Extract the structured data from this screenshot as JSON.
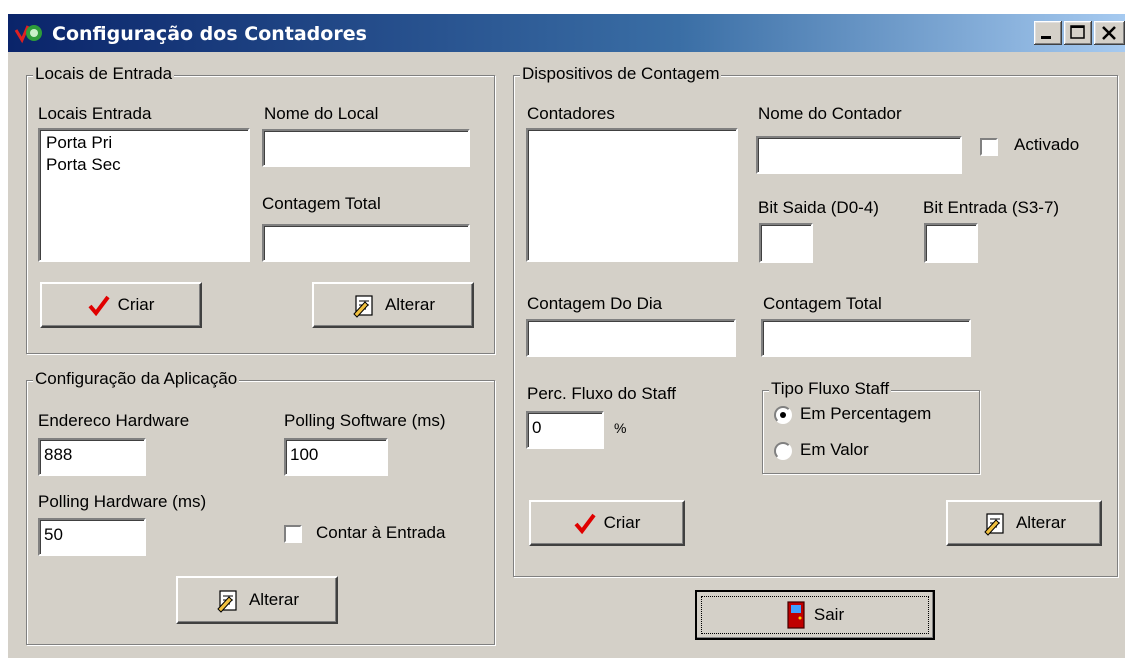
{
  "window": {
    "title": "Configuração dos Contadores"
  },
  "locais": {
    "group_title": "Locais de Entrada",
    "list_label": "Locais Entrada",
    "items": [
      "Porta Pri",
      "Porta Sec"
    ],
    "nome_label": "Nome do Local",
    "nome_value": "",
    "total_label": "Contagem Total",
    "total_value": "",
    "criar_label": "Criar",
    "alterar_label": "Alterar"
  },
  "app": {
    "group_title": "Configuração da Aplicação",
    "endereco_label": "Endereco  Hardware",
    "endereco_value": "888",
    "polling_sw_label": "Polling Software (ms)",
    "polling_sw_value": "100",
    "polling_hw_label": "Polling Hardware (ms)",
    "polling_hw_value": "50",
    "contar_label": "Contar à Entrada",
    "alterar_label": "Alterar"
  },
  "dispositivos": {
    "group_title": "Dispositivos de Contagem",
    "contadores_label": "Contadores",
    "nome_label": "Nome do Contador",
    "nome_value": "",
    "activado_label": "Activado",
    "bit_saida_label": "Bit Saida (D0-4)",
    "bit_saida_value": "",
    "bit_entrada_label": "Bit Entrada (S3-7)",
    "bit_entrada_value": "",
    "dia_label": "Contagem Do Dia",
    "dia_value": "",
    "total_label": "Contagem Total",
    "total_value": "",
    "perc_label": "Perc. Fluxo do Staff",
    "perc_value": "0",
    "perc_unit": "%",
    "tipo_title": "Tipo Fluxo Staff",
    "radio_percentagem": "Em Percentagem",
    "radio_valor": "Em Valor",
    "criar_label": "Criar",
    "alterar_label": "Alterar"
  },
  "sair_label": "Sair"
}
